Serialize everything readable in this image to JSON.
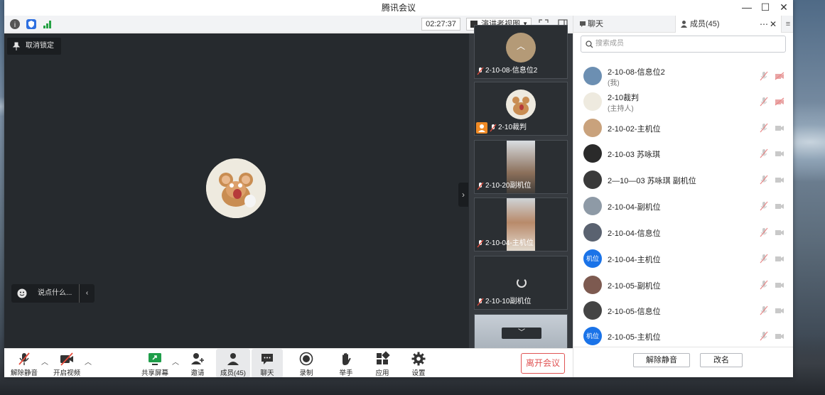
{
  "window": {
    "title": "腾讯会议"
  },
  "toolbar": {
    "timer": "02:27:37",
    "view_mode": "演讲者视图"
  },
  "main": {
    "unpin_label": "取消锁定",
    "say_placeholder": "说点什么..."
  },
  "tiles": [
    {
      "name": "2-10-08-信息位2"
    },
    {
      "name": "2-10裁判"
    },
    {
      "name": "2-10-20副机位"
    },
    {
      "name": "2-10-04-主机位"
    },
    {
      "name": "2-10-10副机位"
    },
    {
      "name": ""
    }
  ],
  "bottombar": {
    "unmute": "解除静音",
    "start_video": "开启视频",
    "share_screen": "共享屏幕",
    "invite": "邀请",
    "members": "成员(45)",
    "chat": "聊天",
    "record": "录制",
    "raise_hand": "举手",
    "apps": "应用",
    "settings": "设置",
    "leave": "离开会议"
  },
  "panel": {
    "tab_chat": "聊天",
    "tab_members": "成员(45)",
    "search_placeholder": "搜索成员",
    "members": [
      {
        "name": "2-10-08-信息位2",
        "role": "(我)"
      },
      {
        "name": "2-10裁判",
        "role": "(主持人)"
      },
      {
        "name": "2-10-02-主机位",
        "role": ""
      },
      {
        "name": "2-10-03 苏咏琪",
        "role": ""
      },
      {
        "name": "2—10—03 苏咏琪 副机位",
        "role": ""
      },
      {
        "name": "2-10-04-副机位",
        "role": ""
      },
      {
        "name": "2-10-04-信息位",
        "role": ""
      },
      {
        "name": "2-10-04-主机位",
        "role": "",
        "avatar_text": "机位"
      },
      {
        "name": "2-10-05-副机位",
        "role": ""
      },
      {
        "name": "2-10-05-信息位",
        "role": ""
      },
      {
        "name": "2-10-05-主机位",
        "role": "",
        "avatar_text": "机位"
      }
    ],
    "unmute_all": "解除静音",
    "rename": "改名"
  },
  "colors": {
    "accent": "#1a73e8",
    "leave": "#e05454",
    "main_bg": "#262a2e"
  }
}
